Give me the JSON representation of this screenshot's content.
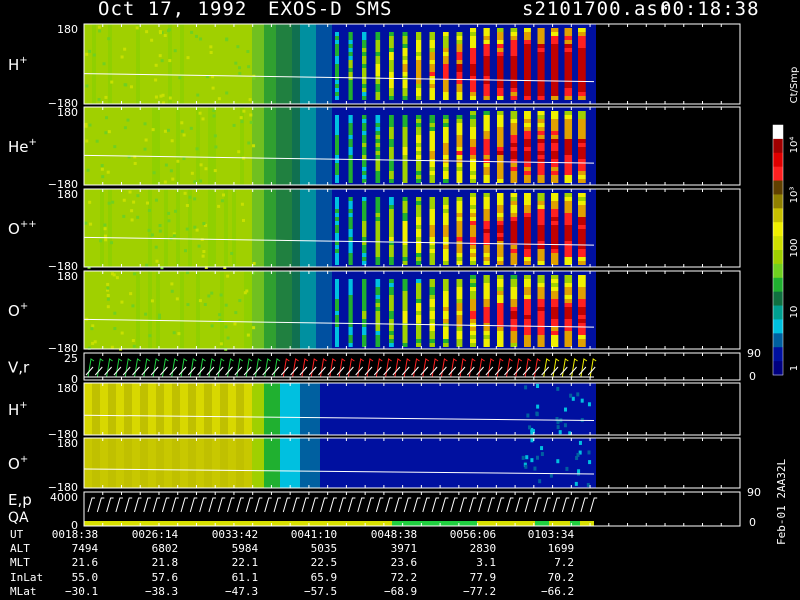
{
  "header": {
    "date": "Oct 17, 1992",
    "instrument": "EXOS-D SMS",
    "filename": "s2101700.asr",
    "time": "00:18:38"
  },
  "colorbar": {
    "unit_label": "Ct/Smp",
    "tick_labels": [
      "10⁴",
      "10³",
      "100",
      "10",
      "1"
    ],
    "colors": [
      "#ffffff",
      "#a00000",
      "#e00000",
      "#ff2020",
      "#604000",
      "#908000",
      "#c8c000",
      "#f0f000",
      "#d0e000",
      "#a0d000",
      "#70d020",
      "#20b030",
      "#107040",
      "#00a090",
      "#00c0e0",
      "#0060a0",
      "#0010a0",
      "#000080"
    ]
  },
  "panels": [
    {
      "id": "h-plus",
      "label": "H",
      "sup": "+",
      "ytop": "180",
      "ybot": "−180"
    },
    {
      "id": "he-plus",
      "label": "He",
      "sup": "+",
      "ytop": "180",
      "ybot": "−180"
    },
    {
      "id": "o-plusplus",
      "label": "O",
      "sup": "++",
      "ytop": "180",
      "ybot": "−180"
    },
    {
      "id": "o-plus",
      "label": "O",
      "sup": "+",
      "ytop": "180",
      "ybot": "−180"
    },
    {
      "id": "vr",
      "label": "V,r",
      "ytop": "25",
      "ybot": "0",
      "right_top": "90",
      "right_bot": "0"
    },
    {
      "id": "h-plus-2",
      "label": "H",
      "sup": "+",
      "ytop": "180",
      "ybot": "−180"
    },
    {
      "id": "o-plus-2",
      "label": "O",
      "sup": "+",
      "ytop": "180",
      "ybot": "−180"
    },
    {
      "id": "ep",
      "label": "E,p",
      "label2": "QA",
      "ytop": "4000",
      "ybot": "0",
      "right_top": "90",
      "right_bot": "0"
    }
  ],
  "table": {
    "columns": [
      "0018:38",
      "0026:14",
      "0033:42",
      "0041:10",
      "0048:38",
      "0056:06",
      "0103:34"
    ],
    "rows": [
      {
        "label": "UT",
        "values": [
          "0018:38",
          "0026:14",
          "0033:42",
          "0041:10",
          "0048:38",
          "0056:06",
          "0103:34"
        ]
      },
      {
        "label": "ALT",
        "values": [
          "7494",
          "6802",
          "5984",
          "5035",
          "3971",
          "2830",
          "1699"
        ]
      },
      {
        "label": "MLT",
        "values": [
          "21.6",
          "21.8",
          "22.1",
          "22.5",
          "23.6",
          "3.1",
          "7.2"
        ]
      },
      {
        "label": "InLat",
        "values": [
          "55.0",
          "57.6",
          "61.1",
          "65.9",
          "72.2",
          "77.9",
          "70.2"
        ]
      },
      {
        "label": "MLat",
        "values": [
          "−30.1",
          "−38.3",
          "−47.3",
          "−57.5",
          "−68.9",
          "−77.2",
          "−66.2"
        ]
      }
    ]
  },
  "side_id": "Feb-01 2AA32L",
  "chart_data": {
    "type": "heatmap",
    "title": "Oct 17, 1992  EXOS-D SMS  s2101700.asr  00:18:38",
    "x_ticks": [
      "0018:38",
      "0026:14",
      "0033:42",
      "0041:10",
      "0048:38",
      "0056:06",
      "0103:34"
    ],
    "series": [
      {
        "name": "H+",
        "ylim": [
          -180,
          180
        ]
      },
      {
        "name": "He+",
        "ylim": [
          -180,
          180
        ]
      },
      {
        "name": "O++",
        "ylim": [
          -180,
          180
        ]
      },
      {
        "name": "O+",
        "ylim": [
          -180,
          180
        ]
      },
      {
        "name": "V,r",
        "ylim": [
          0,
          25
        ],
        "right_ylim": [
          0,
          90
        ]
      },
      {
        "name": "H+",
        "ylim": [
          -180,
          180
        ]
      },
      {
        "name": "O+",
        "ylim": [
          -180,
          180
        ]
      },
      {
        "name": "E,p",
        "ylim": [
          0,
          4000
        ],
        "right_ylim": [
          0,
          90
        ]
      }
    ],
    "colorbar": {
      "label": "Ct/Smp",
      "log_scale": true,
      "range": [
        1,
        10000
      ]
    }
  }
}
